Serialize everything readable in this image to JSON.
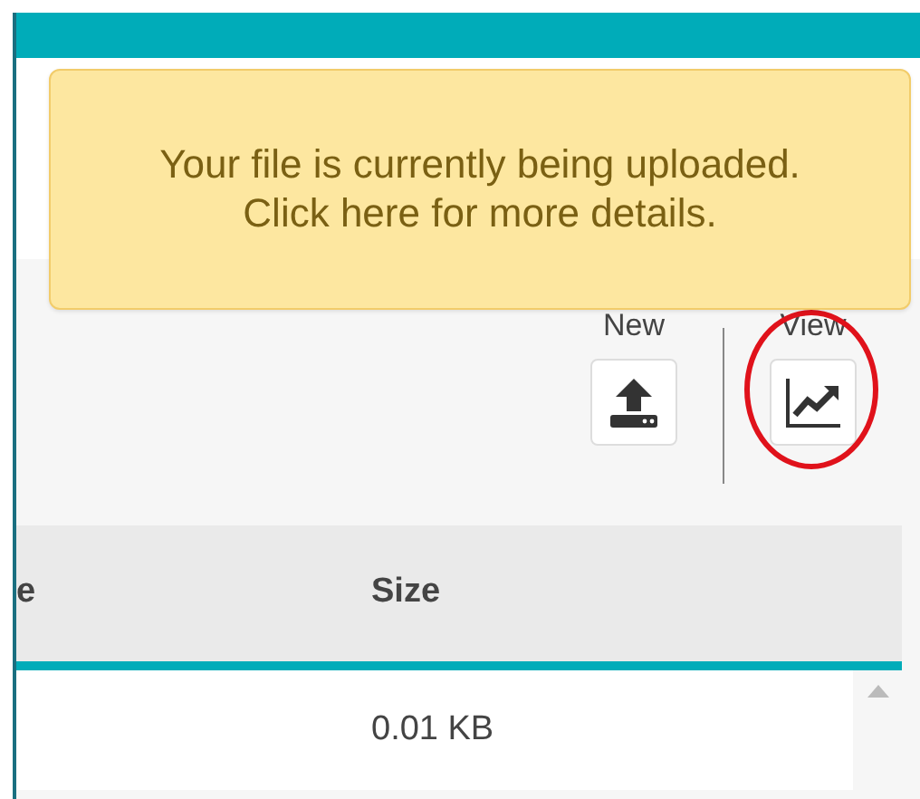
{
  "alert": {
    "text": "Your file is currently being uploaded. Click here for more details."
  },
  "toolbar": [
    {
      "label": "New",
      "kind": "upload"
    },
    {
      "label": "View",
      "kind": "chart",
      "circled": true
    }
  ],
  "table": {
    "columns": [
      {
        "label": "e"
      },
      {
        "label": "Size"
      }
    ],
    "rows": [
      {
        "cells": [
          "",
          "0.01 KB"
        ]
      }
    ]
  }
}
